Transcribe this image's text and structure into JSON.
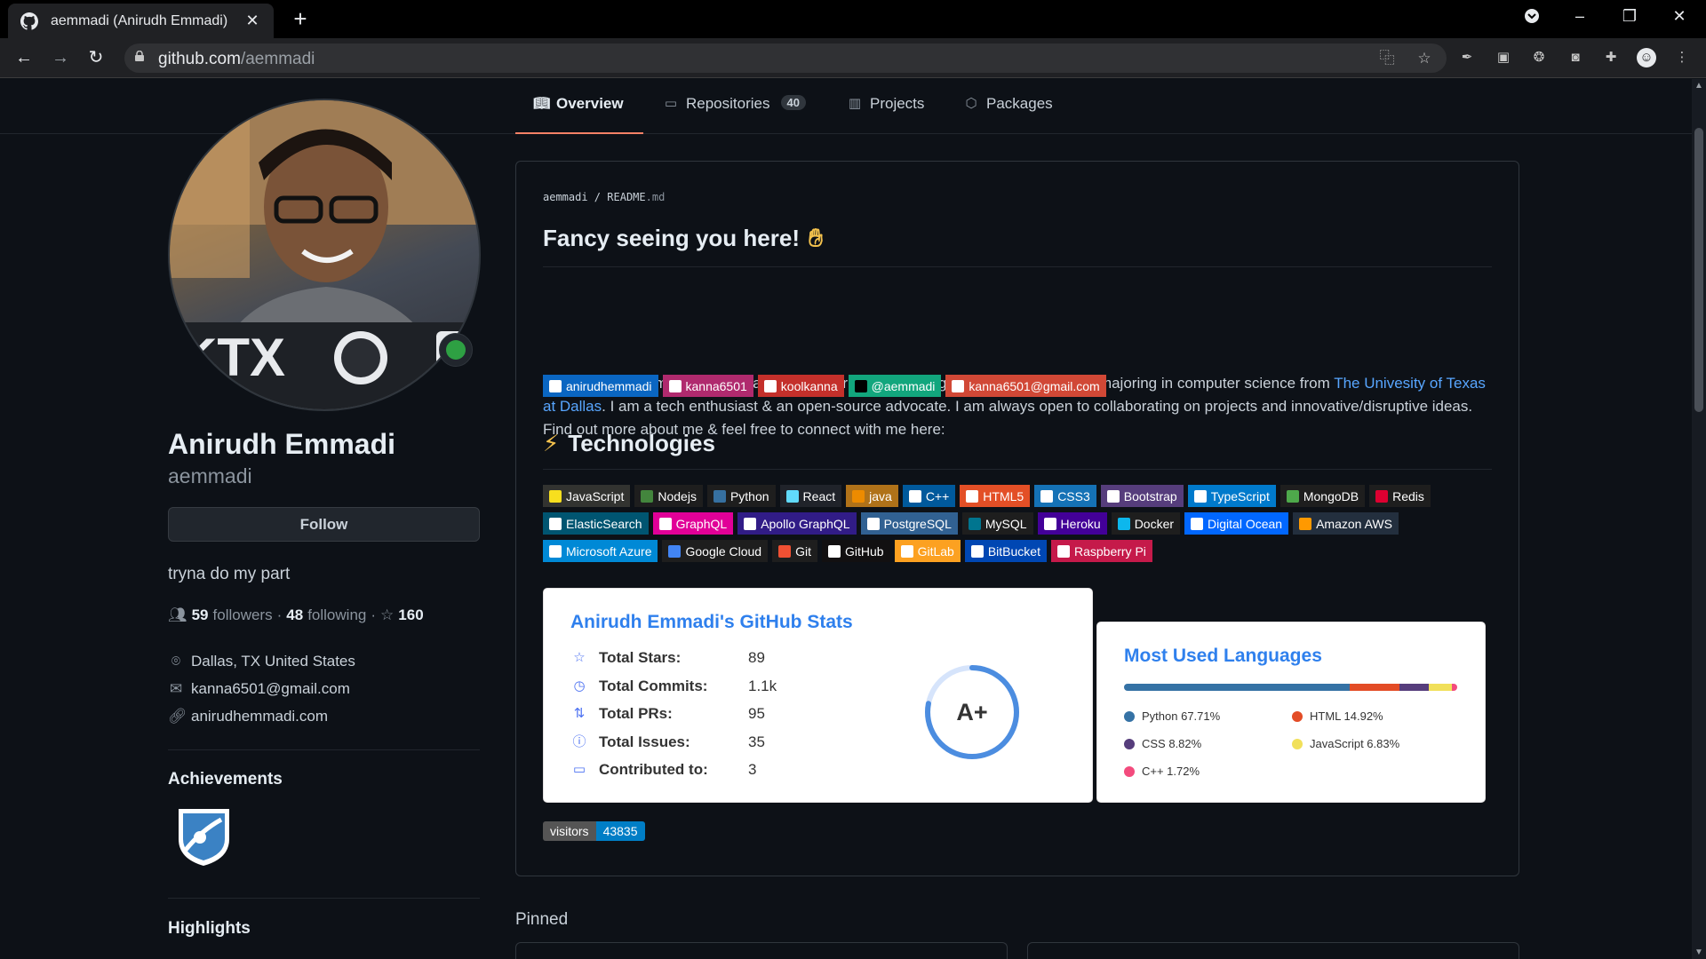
{
  "browser": {
    "tab_title": "aemmadi (Anirudh Emmadi)",
    "url_host": "github.com",
    "url_path": "/aemmadi"
  },
  "nav": {
    "overview": "Overview",
    "repositories": "Repositories",
    "repositories_count": "40",
    "projects": "Projects",
    "packages": "Packages"
  },
  "profile": {
    "fullname": "Anirudh Emmadi",
    "username": "aemmadi",
    "follow_label": "Follow",
    "bio": "tryna do my part",
    "followers_count": "59",
    "followers_label": "followers",
    "following_count": "48",
    "following_label": "following",
    "stars_count": "160",
    "location": "Dallas, TX United States",
    "email": "kanna6501@gmail.com",
    "website": "anirudhemmadi.com",
    "achievements_title": "Achievements",
    "highlights_title": "Highlights"
  },
  "readme": {
    "path_user": "aemmadi",
    "path_file": "README",
    "path_ext": ".md",
    "heading": "Fancy seeing you here!",
    "intro_before_link": "I am Anirudh Emmadi, people call me Ani, currently pursuing my bachelor's degree majoring in computer science from ",
    "intro_link": "The Univesity of Texas at Dallas",
    "intro_after_link": ". I am a tech enthusiast & an open-source advocate. I am always open to collaborating on projects and innovative/disruptive ideas. Find out more about me & feel free to connect with me here:",
    "social": [
      {
        "label": "anirudhemmadi",
        "color": "#0a66c2",
        "icon_color": "#ffffff"
      },
      {
        "label": "kanna6501",
        "color": "#b02a6e",
        "icon_color": "#ffffff"
      },
      {
        "label": "koolkanna",
        "color": "#c4302b",
        "icon_color": "#ffffff"
      },
      {
        "label": "@aemmadi",
        "color": "#12a67d",
        "icon_color": "#000000"
      },
      {
        "label": "kanna6501@gmail.com",
        "color": "#d14836",
        "icon_color": "#ffffff"
      }
    ],
    "tech_heading": "Technologies",
    "tech_rows": [
      [
        {
          "label": "JavaScript",
          "color": "#323330",
          "icon_color": "#f7df1e"
        },
        {
          "label": "Nodejs",
          "color": "#1e1e1e",
          "icon_color": "#43853d"
        },
        {
          "label": "Python",
          "color": "#1e1e1e",
          "icon_color": "#3670a0"
        },
        {
          "label": "React",
          "color": "#20232a",
          "icon_color": "#61dafb"
        },
        {
          "label": "java",
          "color": "#b07219",
          "icon_color": "#ed8b00"
        },
        {
          "label": "C++",
          "color": "#00599c",
          "icon_color": "#ffffff"
        },
        {
          "label": "HTML5",
          "color": "#e34f26",
          "icon_color": "#ffffff"
        },
        {
          "label": "CSS3",
          "color": "#1572b6",
          "icon_color": "#ffffff"
        },
        {
          "label": "Bootstrap",
          "color": "#563d7c",
          "icon_color": "#ffffff"
        },
        {
          "label": "TypeScript",
          "color": "#007acc",
          "icon_color": "#ffffff"
        },
        {
          "label": "MongoDB",
          "color": "#1e1e1e",
          "icon_color": "#4ea94b"
        },
        {
          "label": "Redis",
          "color": "#1e1e1e",
          "icon_color": "#dd0031"
        }
      ],
      [
        {
          "label": "ElasticSearch",
          "color": "#005571",
          "icon_color": "#ffffff"
        },
        {
          "label": "GraphQL",
          "color": "#e10098",
          "icon_color": "#ffffff"
        },
        {
          "label": "Apollo GraphQL",
          "color": "#311c87",
          "icon_color": "#ffffff"
        },
        {
          "label": "PostgreSQL",
          "color": "#316192",
          "icon_color": "#ffffff"
        },
        {
          "label": "MySQL",
          "color": "#1e1e1e",
          "icon_color": "#00758f"
        },
        {
          "label": "Heroku",
          "color": "#430098",
          "icon_color": "#ffffff"
        },
        {
          "label": "Docker",
          "color": "#1e1e1e",
          "icon_color": "#0db7ed"
        },
        {
          "label": "Digital Ocean",
          "color": "#0167ff",
          "icon_color": "#ffffff"
        },
        {
          "label": "Amazon AWS",
          "color": "#232f3e",
          "icon_color": "#ff9900"
        }
      ],
      [
        {
          "label": "Microsoft Azure",
          "color": "#0089d6",
          "icon_color": "#ffffff"
        },
        {
          "label": "Google Cloud",
          "color": "#1e1e1e",
          "icon_color": "#4285f4"
        },
        {
          "label": "Git",
          "color": "#1e1e1e",
          "icon_color": "#f05033"
        },
        {
          "label": "GitHub",
          "color": "#121011",
          "icon_color": "#ffffff"
        },
        {
          "label": "GitLab",
          "color": "#fca121",
          "icon_color": "#ffffff"
        },
        {
          "label": "BitBucket",
          "color": "#0047b3",
          "icon_color": "#ffffff"
        },
        {
          "label": "Raspberry Pi",
          "color": "#c51a4a",
          "icon_color": "#ffffff"
        }
      ]
    ],
    "stats_card": {
      "title": "Anirudh Emmadi's GitHub Stats",
      "rows": [
        {
          "icon": "star-icon",
          "label": "Total Stars:",
          "value": "89"
        },
        {
          "icon": "history-icon",
          "label": "Total Commits:",
          "value": "1.1k"
        },
        {
          "icon": "pull-request-icon",
          "label": "Total PRs:",
          "value": "95"
        },
        {
          "icon": "issue-icon",
          "label": "Total Issues:",
          "value": "35"
        },
        {
          "icon": "repo-icon",
          "label": "Contributed to:",
          "value": "3"
        }
      ],
      "rank": "A+",
      "rank_progress": 0.78
    },
    "lang_card": {
      "title": "Most Used Languages",
      "languages": [
        {
          "name": "Python",
          "percent": 67.71,
          "label": "Python 67.71%",
          "color": "#3572a5"
        },
        {
          "name": "HTML",
          "percent": 14.92,
          "label": "HTML 14.92%",
          "color": "#e34c26"
        },
        {
          "name": "CSS",
          "percent": 8.82,
          "label": "CSS 8.82%",
          "color": "#563d7c"
        },
        {
          "name": "JavaScript",
          "percent": 6.83,
          "label": "JavaScript 6.83%",
          "color": "#f1e05a"
        },
        {
          "name": "C++",
          "percent": 1.72,
          "label": "C++ 1.72%",
          "color": "#f34b7d"
        }
      ]
    },
    "visitors_label": "visitors",
    "visitors_count": "43835"
  },
  "pinned_title": "Pinned",
  "colors": {
    "accent_link": "#58a6ff",
    "active_tab_underline": "#f78166",
    "background": "#0d1117"
  }
}
